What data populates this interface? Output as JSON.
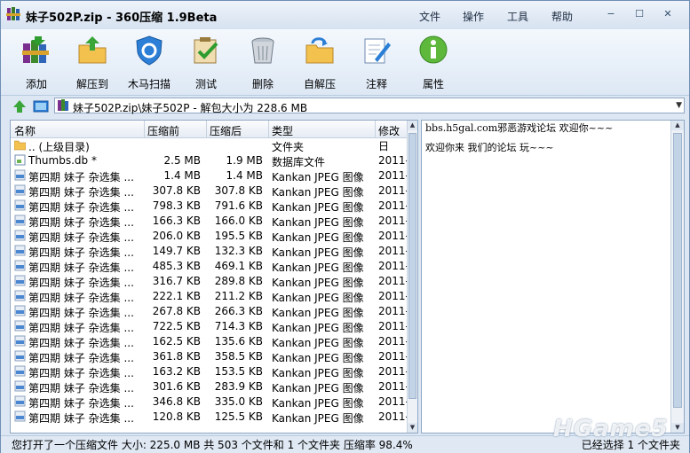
{
  "window": {
    "title": "妹子502P.zip - 360压缩 1.9Beta",
    "menu": [
      "文件",
      "操作",
      "工具",
      "帮助"
    ],
    "controls": [
      "−",
      "☐",
      "✕"
    ]
  },
  "toolbar": {
    "items": [
      {
        "label": "添加",
        "icon": "add-books-icon"
      },
      {
        "label": "解压到",
        "icon": "extract-folder-icon"
      },
      {
        "label": "木马扫描",
        "icon": "shield-scan-icon"
      },
      {
        "label": "测试",
        "icon": "test-check-icon"
      },
      {
        "label": "删除",
        "icon": "trash-icon"
      },
      {
        "label": "自解压",
        "icon": "self-extract-icon"
      },
      {
        "label": "注释",
        "icon": "comment-pencil-icon"
      },
      {
        "label": "属性",
        "icon": "info-icon"
      }
    ]
  },
  "path": {
    "text": "妹子502P.zip\\妹子502P - 解包大小为 228.6 MB"
  },
  "list": {
    "columns": [
      "名称",
      "压缩前",
      "压缩后",
      "类型",
      "修改日"
    ],
    "rows": [
      {
        "name": ".. (上级目录)",
        "comp": "",
        "orig": "",
        "type": "文件夹",
        "date": "",
        "icon": "folder"
      },
      {
        "name": "Thumbs.db *",
        "comp": "2.5 MB",
        "orig": "1.9 MB",
        "type": "数据库文件",
        "date": "2011-",
        "icon": "db"
      },
      {
        "name": "第四期 妹子  杂选集 ...",
        "comp": "1.4 MB",
        "orig": "1.4 MB",
        "type": "Kankan JPEG 图像",
        "date": "2011-",
        "icon": "jpg"
      },
      {
        "name": "第四期 妹子  杂选集 ...",
        "comp": "307.8 KB",
        "orig": "307.8 KB",
        "type": "Kankan JPEG 图像",
        "date": "2011-",
        "icon": "jpg"
      },
      {
        "name": "第四期 妹子  杂选集 ...",
        "comp": "798.3 KB",
        "orig": "791.6 KB",
        "type": "Kankan JPEG 图像",
        "date": "2011-",
        "icon": "jpg"
      },
      {
        "name": "第四期 妹子  杂选集 ...",
        "comp": "166.3 KB",
        "orig": "166.0 KB",
        "type": "Kankan JPEG 图像",
        "date": "2011-",
        "icon": "jpg"
      },
      {
        "name": "第四期 妹子  杂选集 ...",
        "comp": "206.0 KB",
        "orig": "195.5 KB",
        "type": "Kankan JPEG 图像",
        "date": "2011-",
        "icon": "jpg"
      },
      {
        "name": "第四期 妹子  杂选集 ...",
        "comp": "149.7 KB",
        "orig": "132.3 KB",
        "type": "Kankan JPEG 图像",
        "date": "2011-",
        "icon": "jpg"
      },
      {
        "name": "第四期 妹子  杂选集 ...",
        "comp": "485.3 KB",
        "orig": "469.1 KB",
        "type": "Kankan JPEG 图像",
        "date": "2011-",
        "icon": "jpg"
      },
      {
        "name": "第四期 妹子  杂选集 ...",
        "comp": "316.7 KB",
        "orig": "289.8 KB",
        "type": "Kankan JPEG 图像",
        "date": "2011-",
        "icon": "jpg"
      },
      {
        "name": "第四期 妹子  杂选集 ...",
        "comp": "222.1 KB",
        "orig": "211.2 KB",
        "type": "Kankan JPEG 图像",
        "date": "2011-",
        "icon": "jpg"
      },
      {
        "name": "第四期 妹子  杂选集 ...",
        "comp": "267.8 KB",
        "orig": "266.3 KB",
        "type": "Kankan JPEG 图像",
        "date": "2011-",
        "icon": "jpg"
      },
      {
        "name": "第四期 妹子  杂选集 ...",
        "comp": "722.5 KB",
        "orig": "714.3 KB",
        "type": "Kankan JPEG 图像",
        "date": "2011-",
        "icon": "jpg"
      },
      {
        "name": "第四期 妹子  杂选集 ...",
        "comp": "162.5 KB",
        "orig": "135.6 KB",
        "type": "Kankan JPEG 图像",
        "date": "2011-",
        "icon": "jpg"
      },
      {
        "name": "第四期 妹子  杂选集 ...",
        "comp": "361.8 KB",
        "orig": "358.5 KB",
        "type": "Kankan JPEG 图像",
        "date": "2011-",
        "icon": "jpg"
      },
      {
        "name": "第四期 妹子  杂选集 ...",
        "comp": "163.2 KB",
        "orig": "153.5 KB",
        "type": "Kankan JPEG 图像",
        "date": "2011-",
        "icon": "jpg"
      },
      {
        "name": "第四期 妹子  杂选集 ...",
        "comp": "301.6 KB",
        "orig": "283.9 KB",
        "type": "Kankan JPEG 图像",
        "date": "2011-",
        "icon": "jpg"
      },
      {
        "name": "第四期 妹子  杂选集 ...",
        "comp": "346.8 KB",
        "orig": "335.0 KB",
        "type": "Kankan JPEG 图像",
        "date": "2011-",
        "icon": "jpg"
      },
      {
        "name": "第四期 妹子  杂选集 ...",
        "comp": "120.8 KB",
        "orig": "125.5 KB",
        "type": "Kankan JPEG 图像",
        "date": "2011-",
        "icon": "jpg"
      }
    ]
  },
  "preview": {
    "line1": "bbs.h5gal.com邪恶游戏论坛 欢迎你~~~",
    "line2": "欢迎你来 我们的论坛 玩~~~"
  },
  "status": {
    "left": "您打开了一个压缩文件 大小: 225.0 MB 共 503 个文件和 1 个文件夹 压缩率 98.4%",
    "right": "已经选择 1 个文件夹"
  },
  "watermark": "HGame5",
  "colors": {
    "accent": "#1d6fd0",
    "window_bg": "#dde7f3"
  }
}
